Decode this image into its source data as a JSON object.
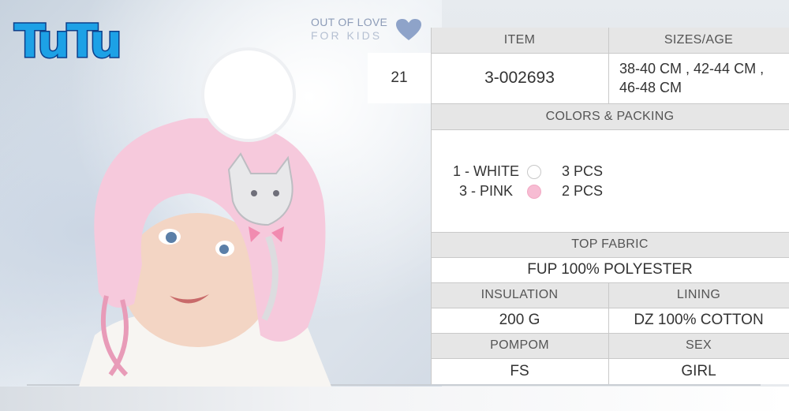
{
  "brand": {
    "logo_text": "TuTu",
    "tagline_line1": "OUT OF LOVE",
    "tagline_line2": "FOR KIDS"
  },
  "colors": {
    "header_bg": "#e6e6e6",
    "value_bg": "#ffffff",
    "brand_blue": "#1da1e6",
    "hat_pink": "#f6c9dc",
    "swatch_white": "#ffffff",
    "swatch_pink": "#f7bcd3"
  },
  "product": {
    "index": "21",
    "item_label": "ITEM",
    "item_value": "3-002693",
    "sizes_label": "SIZES/AGE",
    "sizes_line1": "38-40 CM , 42-44 CM ,",
    "sizes_line2": "46-48 CM"
  },
  "colors_packing": {
    "label": "COLORS & PACKING",
    "rows": [
      {
        "name": "1 - WHITE",
        "swatch": "white-swatch",
        "qty": "3 PCS"
      },
      {
        "name": "3 - PINK",
        "swatch": "pink-swatch",
        "qty": "2 PCS"
      }
    ]
  },
  "top_fabric": {
    "label": "TOP FABRIC",
    "value": "FUP 100% POLYESTER"
  },
  "insulation": {
    "label": "INSULATION",
    "value": "200 G"
  },
  "lining": {
    "label": "LINING",
    "value": "DZ 100% COTTON"
  },
  "pompom": {
    "label": "POMPOM",
    "value": "FS"
  },
  "sex": {
    "label": "SEX",
    "value": "GIRL"
  }
}
